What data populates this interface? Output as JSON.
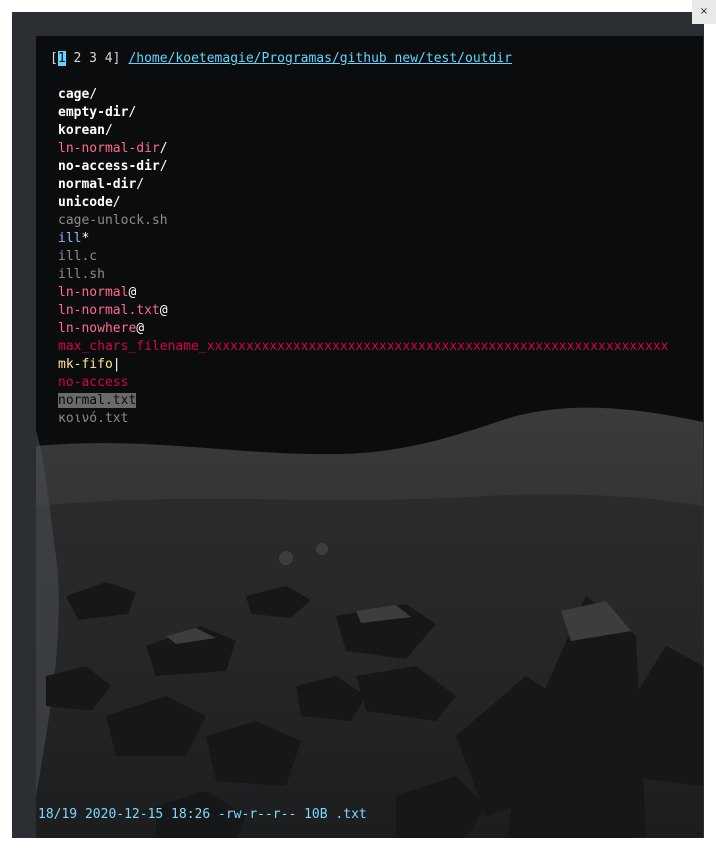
{
  "close_label": "×",
  "tabs": {
    "open_bracket": "[",
    "active": "1",
    "others": " 2 3 4",
    "close_bracket": "]"
  },
  "cwd": "/home/koetemagie/Programas/github new/test/outdir",
  "files": [
    {
      "name": "cage",
      "suffix": "/",
      "type": "dir"
    },
    {
      "name": "empty-dir",
      "suffix": "/",
      "type": "dir"
    },
    {
      "name": "korean",
      "suffix": "/",
      "type": "dir"
    },
    {
      "name": "ln-normal-dir",
      "suffix": "/",
      "type": "link-dir"
    },
    {
      "name": "no-access-dir",
      "suffix": "/",
      "type": "dir"
    },
    {
      "name": "normal-dir",
      "suffix": "/",
      "type": "dir"
    },
    {
      "name": "unicode",
      "suffix": "/",
      "type": "dir"
    },
    {
      "name": "cage-unlock.sh",
      "suffix": "",
      "type": "file"
    },
    {
      "name": "ill",
      "suffix": "*",
      "type": "exec"
    },
    {
      "name": "ill.c",
      "suffix": "",
      "type": "file"
    },
    {
      "name": "ill.sh",
      "suffix": "",
      "type": "file"
    },
    {
      "name": "ln-normal",
      "suffix": "@",
      "type": "link"
    },
    {
      "name": "ln-normal.txt",
      "suffix": "@",
      "type": "link"
    },
    {
      "name": "ln-nowhere",
      "suffix": "@",
      "type": "link"
    },
    {
      "name": "max_chars_filename_xxxxxxxxxxxxxxxxxxxxxxxxxxxxxxxxxxxxxxxxxxxxxxxxxxxxxxxxxxx",
      "suffix": "",
      "type": "long"
    },
    {
      "name": "mk-fifo",
      "suffix": "|",
      "type": "fifo"
    },
    {
      "name": "no-access",
      "suffix": "",
      "type": "noaccess"
    },
    {
      "name": "normal.txt",
      "suffix": "",
      "type": "selected"
    },
    {
      "name": "κοινό.txt",
      "suffix": "",
      "type": "file"
    }
  ],
  "status": "18/19 2020-12-15 18:26 -rw-r--r-- 10B .txt",
  "colors": {
    "accent_cyan": "#5fd7ff",
    "link_pink": "#ff6b8f",
    "alert_red": "#d4004f",
    "fifo_yellow": "#ffe78a",
    "exec_blue": "#8fb6ff",
    "plain_gray": "#8b8b8b"
  }
}
